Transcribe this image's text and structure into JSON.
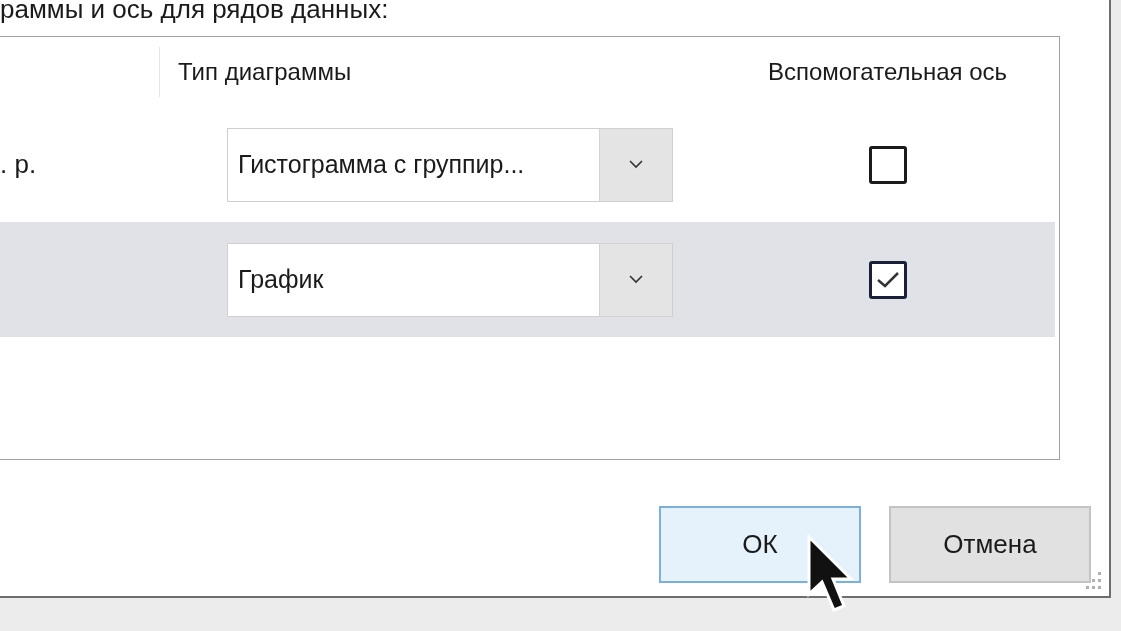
{
  "instruction": "раммы и ось для рядов данных:",
  "table": {
    "columns": [
      {
        "label": "Тип диаграммы"
      },
      {
        "label": "Вспомогательная ось"
      }
    ],
    "rows": [
      {
        "name": ". р.",
        "chart_type": "Гистограмма с группир...",
        "secondary_axis": false,
        "selected": false
      },
      {
        "chart_type": "График",
        "secondary_axis": true,
        "selected": true
      }
    ]
  },
  "buttons": [
    {
      "label": "ОК",
      "kind": "primary"
    },
    {
      "label": "Отмена",
      "kind": "normal"
    }
  ]
}
